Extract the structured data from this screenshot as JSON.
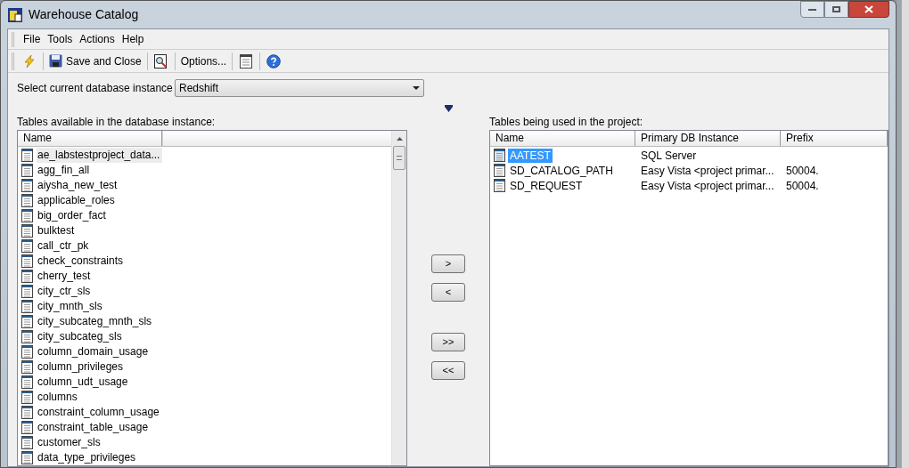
{
  "window": {
    "title": "Warehouse Catalog"
  },
  "menu": [
    "File",
    "Tools",
    "Actions",
    "Help"
  ],
  "toolbar": [
    {
      "kind": "icon"
    },
    {
      "kind": "separator"
    },
    {
      "kind": "icon_button",
      "label": "Save and Close"
    },
    {
      "kind": "separator"
    },
    {
      "kind": "icon"
    },
    {
      "kind": "separator"
    },
    {
      "kind": "button",
      "label": "Options..."
    },
    {
      "kind": "separator"
    },
    {
      "kind": "icon"
    },
    {
      "kind": "separator"
    },
    {
      "kind": "icon"
    }
  ],
  "instance": {
    "label": "Select current database instance",
    "value": "Redshift"
  },
  "available": {
    "label": "Tables available in the database instance:",
    "columns": [
      "Name"
    ],
    "rows": [
      {
        "name": "ae_labstestproject_data...",
        "selected": true
      },
      {
        "name": "agg_fin_all",
        "selected": false
      },
      {
        "name": "aiysha_new_test",
        "selected": false
      },
      {
        "name": "applicable_roles",
        "selected": false
      },
      {
        "name": "big_order_fact",
        "selected": false
      },
      {
        "name": "bulktest",
        "selected": false
      },
      {
        "name": "call_ctr_pk",
        "selected": false
      },
      {
        "name": "check_constraints",
        "selected": false
      },
      {
        "name": "cherry_test",
        "selected": false
      },
      {
        "name": "city_ctr_sls",
        "selected": false
      },
      {
        "name": "city_mnth_sls",
        "selected": false
      },
      {
        "name": "city_subcateg_mnth_sls",
        "selected": false
      },
      {
        "name": "city_subcateg_sls",
        "selected": false
      },
      {
        "name": "column_domain_usage",
        "selected": false
      },
      {
        "name": "column_privileges",
        "selected": false
      },
      {
        "name": "column_udt_usage",
        "selected": false
      },
      {
        "name": "columns",
        "selected": false
      },
      {
        "name": "constraint_column_usage",
        "selected": false
      },
      {
        "name": "constraint_table_usage",
        "selected": false
      },
      {
        "name": "customer_sls",
        "selected": false
      },
      {
        "name": "data_type_privileges",
        "selected": false
      }
    ]
  },
  "move_buttons": [
    ">",
    "<",
    ">>",
    "<<"
  ],
  "used": {
    "label": "Tables being used in the project:",
    "columns": [
      "Name",
      "Primary DB Instance",
      "Prefix"
    ],
    "rows": [
      {
        "name": "AATEST",
        "instance": "SQL Server",
        "selected": true
      },
      {
        "name": "SD_CATALOG_PATH",
        "instance": "Easy Vista <project primar...",
        "prefix": "50004.",
        "selected": false
      },
      {
        "name": "SD_REQUEST",
        "instance": "Easy Vista <project primar...",
        "prefix": "50004.",
        "selected": false
      }
    ]
  }
}
